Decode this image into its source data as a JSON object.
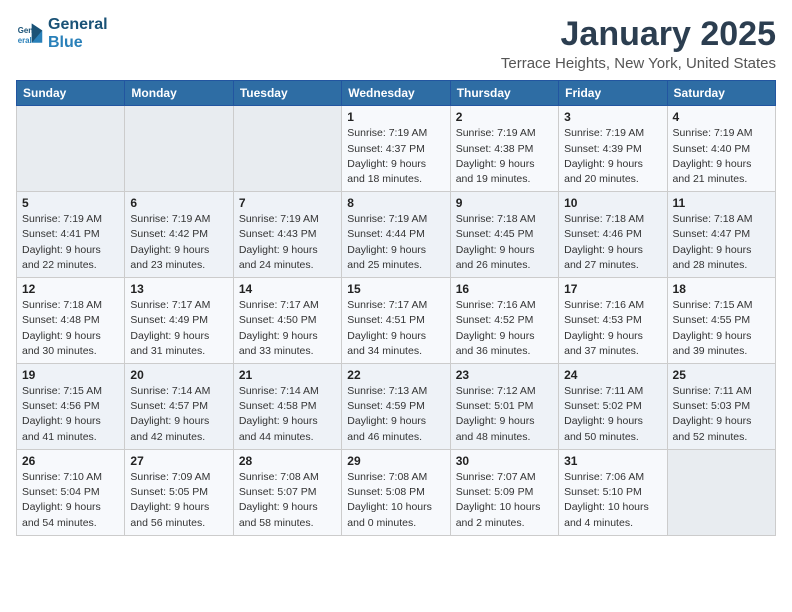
{
  "header": {
    "logo_line1": "General",
    "logo_line2": "Blue",
    "month_title": "January 2025",
    "location": "Terrace Heights, New York, United States"
  },
  "days_of_week": [
    "Sunday",
    "Monday",
    "Tuesday",
    "Wednesday",
    "Thursday",
    "Friday",
    "Saturday"
  ],
  "weeks": [
    [
      {
        "day": "",
        "info": ""
      },
      {
        "day": "",
        "info": ""
      },
      {
        "day": "",
        "info": ""
      },
      {
        "day": "1",
        "info": "Sunrise: 7:19 AM\nSunset: 4:37 PM\nDaylight: 9 hours\nand 18 minutes."
      },
      {
        "day": "2",
        "info": "Sunrise: 7:19 AM\nSunset: 4:38 PM\nDaylight: 9 hours\nand 19 minutes."
      },
      {
        "day": "3",
        "info": "Sunrise: 7:19 AM\nSunset: 4:39 PM\nDaylight: 9 hours\nand 20 minutes."
      },
      {
        "day": "4",
        "info": "Sunrise: 7:19 AM\nSunset: 4:40 PM\nDaylight: 9 hours\nand 21 minutes."
      }
    ],
    [
      {
        "day": "5",
        "info": "Sunrise: 7:19 AM\nSunset: 4:41 PM\nDaylight: 9 hours\nand 22 minutes."
      },
      {
        "day": "6",
        "info": "Sunrise: 7:19 AM\nSunset: 4:42 PM\nDaylight: 9 hours\nand 23 minutes."
      },
      {
        "day": "7",
        "info": "Sunrise: 7:19 AM\nSunset: 4:43 PM\nDaylight: 9 hours\nand 24 minutes."
      },
      {
        "day": "8",
        "info": "Sunrise: 7:19 AM\nSunset: 4:44 PM\nDaylight: 9 hours\nand 25 minutes."
      },
      {
        "day": "9",
        "info": "Sunrise: 7:18 AM\nSunset: 4:45 PM\nDaylight: 9 hours\nand 26 minutes."
      },
      {
        "day": "10",
        "info": "Sunrise: 7:18 AM\nSunset: 4:46 PM\nDaylight: 9 hours\nand 27 minutes."
      },
      {
        "day": "11",
        "info": "Sunrise: 7:18 AM\nSunset: 4:47 PM\nDaylight: 9 hours\nand 28 minutes."
      }
    ],
    [
      {
        "day": "12",
        "info": "Sunrise: 7:18 AM\nSunset: 4:48 PM\nDaylight: 9 hours\nand 30 minutes."
      },
      {
        "day": "13",
        "info": "Sunrise: 7:17 AM\nSunset: 4:49 PM\nDaylight: 9 hours\nand 31 minutes."
      },
      {
        "day": "14",
        "info": "Sunrise: 7:17 AM\nSunset: 4:50 PM\nDaylight: 9 hours\nand 33 minutes."
      },
      {
        "day": "15",
        "info": "Sunrise: 7:17 AM\nSunset: 4:51 PM\nDaylight: 9 hours\nand 34 minutes."
      },
      {
        "day": "16",
        "info": "Sunrise: 7:16 AM\nSunset: 4:52 PM\nDaylight: 9 hours\nand 36 minutes."
      },
      {
        "day": "17",
        "info": "Sunrise: 7:16 AM\nSunset: 4:53 PM\nDaylight: 9 hours\nand 37 minutes."
      },
      {
        "day": "18",
        "info": "Sunrise: 7:15 AM\nSunset: 4:55 PM\nDaylight: 9 hours\nand 39 minutes."
      }
    ],
    [
      {
        "day": "19",
        "info": "Sunrise: 7:15 AM\nSunset: 4:56 PM\nDaylight: 9 hours\nand 41 minutes."
      },
      {
        "day": "20",
        "info": "Sunrise: 7:14 AM\nSunset: 4:57 PM\nDaylight: 9 hours\nand 42 minutes."
      },
      {
        "day": "21",
        "info": "Sunrise: 7:14 AM\nSunset: 4:58 PM\nDaylight: 9 hours\nand 44 minutes."
      },
      {
        "day": "22",
        "info": "Sunrise: 7:13 AM\nSunset: 4:59 PM\nDaylight: 9 hours\nand 46 minutes."
      },
      {
        "day": "23",
        "info": "Sunrise: 7:12 AM\nSunset: 5:01 PM\nDaylight: 9 hours\nand 48 minutes."
      },
      {
        "day": "24",
        "info": "Sunrise: 7:11 AM\nSunset: 5:02 PM\nDaylight: 9 hours\nand 50 minutes."
      },
      {
        "day": "25",
        "info": "Sunrise: 7:11 AM\nSunset: 5:03 PM\nDaylight: 9 hours\nand 52 minutes."
      }
    ],
    [
      {
        "day": "26",
        "info": "Sunrise: 7:10 AM\nSunset: 5:04 PM\nDaylight: 9 hours\nand 54 minutes."
      },
      {
        "day": "27",
        "info": "Sunrise: 7:09 AM\nSunset: 5:05 PM\nDaylight: 9 hours\nand 56 minutes."
      },
      {
        "day": "28",
        "info": "Sunrise: 7:08 AM\nSunset: 5:07 PM\nDaylight: 9 hours\nand 58 minutes."
      },
      {
        "day": "29",
        "info": "Sunrise: 7:08 AM\nSunset: 5:08 PM\nDaylight: 10 hours\nand 0 minutes."
      },
      {
        "day": "30",
        "info": "Sunrise: 7:07 AM\nSunset: 5:09 PM\nDaylight: 10 hours\nand 2 minutes."
      },
      {
        "day": "31",
        "info": "Sunrise: 7:06 AM\nSunset: 5:10 PM\nDaylight: 10 hours\nand 4 minutes."
      },
      {
        "day": "",
        "info": ""
      }
    ]
  ]
}
